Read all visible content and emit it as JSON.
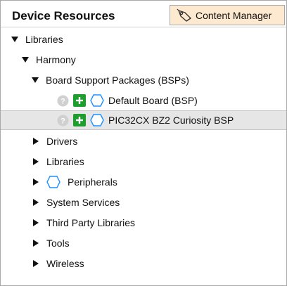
{
  "header": {
    "title": "Device Resources",
    "content_manager_label": "Content Manager",
    "content_manager_bg": "#fde9cf"
  },
  "tree": {
    "root_label": "Libraries",
    "harmony_label": "Harmony",
    "bsp_group_label": "Board Support Packages (BSPs)",
    "bsp_items": [
      {
        "label": "Default Board (BSP)",
        "selected": false
      },
      {
        "label": "PIC32CX BZ2 Curiosity BSP",
        "selected": true
      }
    ],
    "groups": {
      "drivers": "Drivers",
      "libraries": "Libraries",
      "peripherals": "Peripherals",
      "system_services": "System Services",
      "third_party": "Third Party Libraries",
      "tools": "Tools",
      "wireless": "Wireless"
    }
  },
  "icons": {
    "expanded": "triangle-down-icon",
    "collapsed": "triangle-right-icon",
    "help": "question-circle-icon",
    "add": "green-plus-icon",
    "component": "hexagon-icon"
  },
  "colors": {
    "add_green": "#1f9d2f",
    "hexagon_blue": "#1e90ff",
    "selection_bg": "#e6e6e6"
  }
}
